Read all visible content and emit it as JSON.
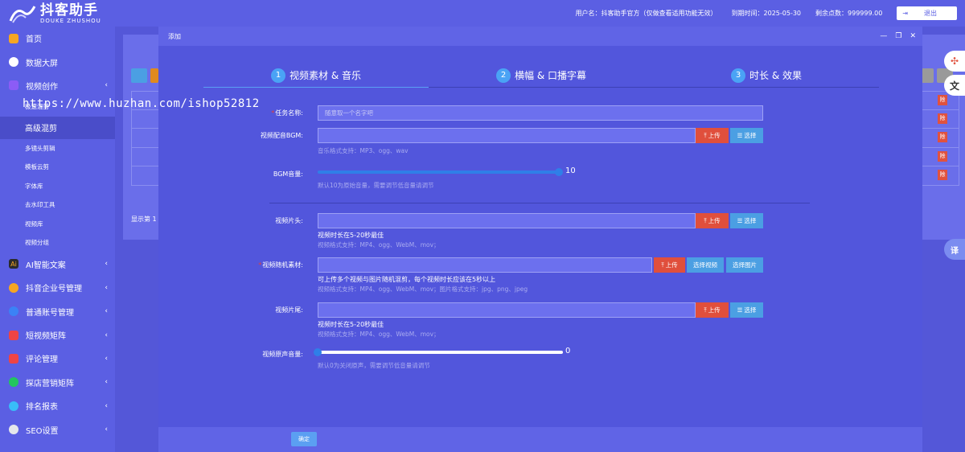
{
  "header": {
    "logo_cn": "抖客助手",
    "logo_en": "DOUKE ZHUSHOU",
    "username": "用户名：抖客助手官方（仅做查看适用功能无效）",
    "expire": "到期时间：2025-05-30",
    "points": "剩余点数：999999.00",
    "logout": "退出"
  },
  "sidebar": {
    "items": [
      {
        "label": "首页",
        "icon": "home-icon"
      },
      {
        "label": "数据大屏",
        "icon": "pie-chart-icon"
      },
      {
        "label": "视频创作",
        "icon": "video-icon"
      },
      {
        "label": "AI智能文案",
        "icon": "ai-icon"
      },
      {
        "label": "抖音企业号管理",
        "icon": "enterprise-icon"
      },
      {
        "label": "普通账号管理",
        "icon": "account-icon"
      },
      {
        "label": "短视频矩阵",
        "icon": "matrix-icon"
      },
      {
        "label": "评论管理",
        "icon": "comment-icon"
      },
      {
        "label": "探店营销矩阵",
        "icon": "store-icon"
      },
      {
        "label": "排名报表",
        "icon": "rank-icon"
      },
      {
        "label": "SEO设置",
        "icon": "seo-icon"
      }
    ],
    "sub_items": [
      "极速混剪",
      "高级混剪",
      "多镜头剪辑",
      "模板云剪",
      "字体库",
      "去水印工具",
      "视频库",
      "视频分组"
    ]
  },
  "background": {
    "delete_label": "除",
    "footer": "显示第 1"
  },
  "watermark": "https://www.huzhan.com/ishop52812",
  "modal": {
    "title": "添加",
    "steps": [
      {
        "num": "1",
        "label": "视频素材 & 音乐"
      },
      {
        "num": "2",
        "label": "横幅 & 口播字幕"
      },
      {
        "num": "3",
        "label": "时长 & 效果"
      }
    ],
    "task_name": {
      "label": "任务名称:",
      "placeholder": "随意取一个名字吧"
    },
    "bgm": {
      "label": "视频配音BGM:",
      "hint": "音乐格式支持：MP3、ogg、wav"
    },
    "bgm_volume": {
      "label": "BGM音量:",
      "value": "10",
      "fraction": 1.0,
      "hint": "默认10为原始音量，需要调节低音量请调节"
    },
    "intro": {
      "label": "视频片头:",
      "tip": "视频时长在5-20秒最佳",
      "hint": "视频格式支持：MP4、ogg、WebM、mov；"
    },
    "random": {
      "label": "视频随机素材:",
      "tip": "可上传多个视频与图片随机混剪，每个视频时长应该在5秒以上",
      "hint": "视频格式支持：MP4、ogg、WebM、mov；图片格式支持：jpg、png、jpeg",
      "select_video": "选择视频",
      "select_image": "选择图片"
    },
    "outro": {
      "label": "视频片尾:",
      "tip": "视频时长在5-20秒最佳",
      "hint": "视频格式支持：MP4、ogg、WebM、mov；"
    },
    "orig_volume": {
      "label": "视频原声音量:",
      "value": "0",
      "fraction": 0.0,
      "hint": "默认0为关闭原声，需要调节低音量请调节"
    },
    "upload": "上传",
    "select": "选择",
    "confirm": "确定"
  },
  "float_icons": {
    "translate": "译"
  },
  "colors": {
    "accent": "#5b5fe3",
    "upload": "#e04f3c",
    "select": "#4b9fe3",
    "slider": "#2f7fe8"
  }
}
